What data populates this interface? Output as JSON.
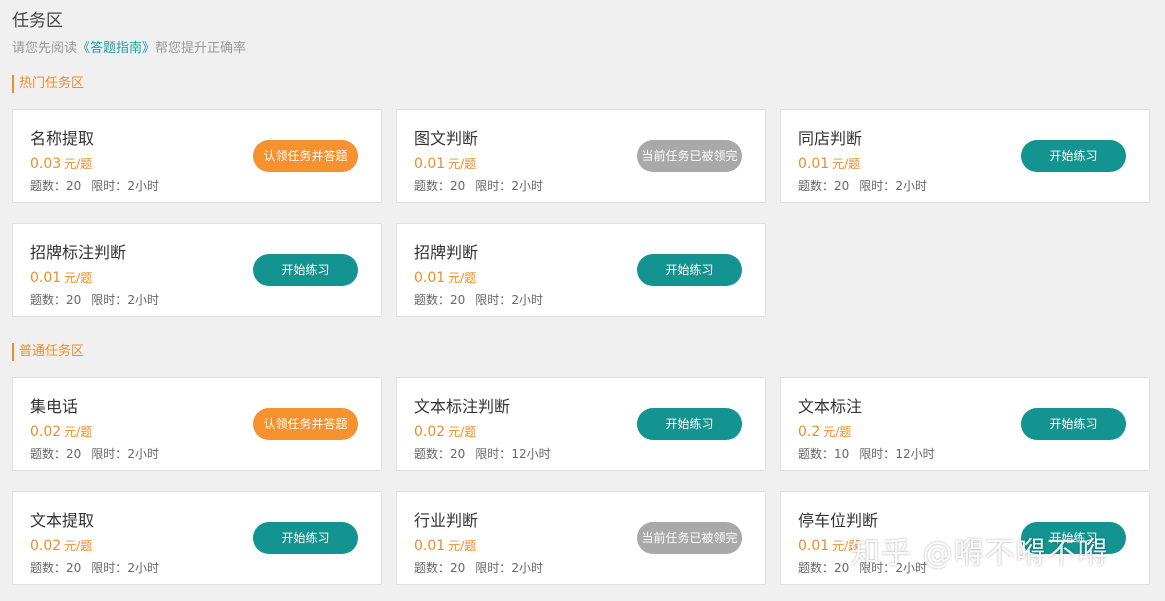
{
  "header": {
    "title": "任务区",
    "subtitle_before": "请您先阅读",
    "guide_link": "《答题指南》",
    "subtitle_after": "帮您提升正确率"
  },
  "sections": [
    {
      "title": "热门任务区",
      "cards": [
        {
          "name": "名称提取",
          "price": "0.03",
          "unit": "元/题",
          "count_label": "题数：",
          "count": "20",
          "limit_label": "限时：",
          "limit": "2小时",
          "button": "认领任务并答题",
          "button_style": "orange"
        },
        {
          "name": "图文判断",
          "price": "0.01",
          "unit": "元/题",
          "count_label": "题数：",
          "count": "20",
          "limit_label": "限时：",
          "limit": "2小时",
          "button": "当前任务已被领完",
          "button_style": "gray"
        },
        {
          "name": "同店判断",
          "price": "0.01",
          "unit": "元/题",
          "count_label": "题数：",
          "count": "20",
          "limit_label": "限时：",
          "limit": "2小时",
          "button": "开始练习",
          "button_style": "teal"
        },
        {
          "name": "招牌标注判断",
          "price": "0.01",
          "unit": "元/题",
          "count_label": "题数：",
          "count": "20",
          "limit_label": "限时：",
          "limit": "2小时",
          "button": "开始练习",
          "button_style": "teal"
        },
        {
          "name": "招牌判断",
          "price": "0.01",
          "unit": "元/题",
          "count_label": "题数：",
          "count": "20",
          "limit_label": "限时：",
          "limit": "2小时",
          "button": "开始练习",
          "button_style": "teal"
        }
      ]
    },
    {
      "title": "普通任务区",
      "cards": [
        {
          "name": "集电话",
          "price": "0.02",
          "unit": "元/题",
          "count_label": "题数：",
          "count": "20",
          "limit_label": "限时：",
          "limit": "2小时",
          "button": "认领任务并答题",
          "button_style": "orange"
        },
        {
          "name": "文本标注判断",
          "price": "0.02",
          "unit": "元/题",
          "count_label": "题数：",
          "count": "20",
          "limit_label": "限时：",
          "limit": "12小时",
          "button": "开始练习",
          "button_style": "teal"
        },
        {
          "name": "文本标注",
          "price": "0.2",
          "unit": "元/题",
          "count_label": "题数：",
          "count": "10",
          "limit_label": "限时：",
          "limit": "12小时",
          "button": "开始练习",
          "button_style": "teal"
        },
        {
          "name": "文本提取",
          "price": "0.02",
          "unit": "元/题",
          "count_label": "题数：",
          "count": "20",
          "limit_label": "限时：",
          "limit": "2小时",
          "button": "开始练习",
          "button_style": "teal"
        },
        {
          "name": "行业判断",
          "price": "0.01",
          "unit": "元/题",
          "count_label": "题数：",
          "count": "20",
          "limit_label": "限时：",
          "limit": "2小时",
          "button": "当前任务已被领完",
          "button_style": "gray"
        },
        {
          "name": "停车位判断",
          "price": "0.01",
          "unit": "元/题",
          "count_label": "题数：",
          "count": "20",
          "limit_label": "限时：",
          "limit": "2小时",
          "button": "开始练习",
          "button_style": "teal"
        }
      ]
    }
  ],
  "watermark": "知乎 @嘚不嘚不嘚",
  "colors": {
    "accent_orange": "#f08c28",
    "button_teal": "#139490",
    "button_orange": "#f5912e",
    "button_gray": "#a9a9a9",
    "link_teal": "#1aa3a0"
  }
}
